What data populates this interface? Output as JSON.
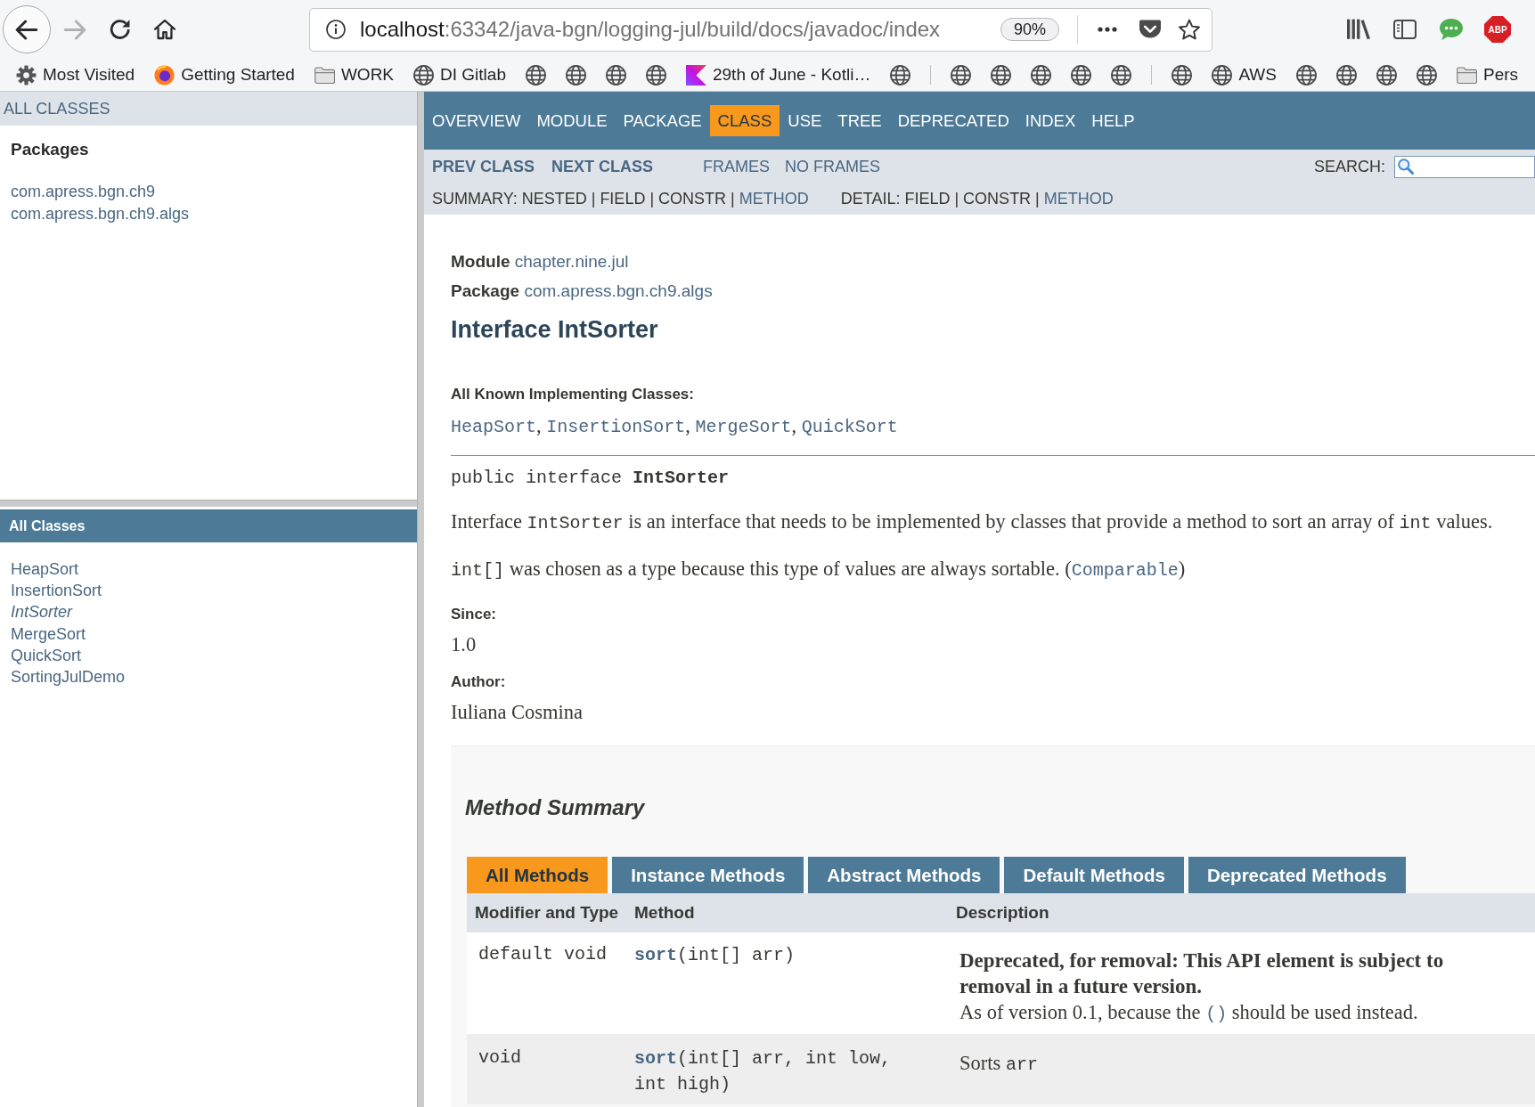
{
  "browser": {
    "nav_buttons": [
      {
        "kind": "back",
        "disabled": false
      },
      {
        "kind": "forward",
        "disabled": true
      },
      {
        "kind": "reload",
        "disabled": false
      },
      {
        "kind": "home",
        "disabled": false
      }
    ],
    "address": {
      "host": "localhost",
      "path": ":63342/java-bgn/logging-jul/build/docs/javadoc/index",
      "zoom": "90%"
    },
    "adblock_label": "ABP",
    "bookmarks": [
      {
        "kind": "gear",
        "label": "Most Visited"
      },
      {
        "kind": "app_logo",
        "label": "Getting Started"
      },
      {
        "kind": "folder",
        "label": "WORK"
      },
      {
        "kind": "globe",
        "label": "DI Gitlab"
      },
      {
        "kind": "globe"
      },
      {
        "kind": "globe"
      },
      {
        "kind": "globe"
      },
      {
        "kind": "globe"
      },
      {
        "kind": "k_logo",
        "label": "29th of June - Kotli…"
      },
      {
        "kind": "globe"
      },
      {
        "kind": "separator"
      },
      {
        "kind": "globe"
      },
      {
        "kind": "globe"
      },
      {
        "kind": "globe"
      },
      {
        "kind": "globe"
      },
      {
        "kind": "globe"
      },
      {
        "kind": "separator"
      },
      {
        "kind": "globe"
      },
      {
        "kind": "globe",
        "label": "AWS"
      },
      {
        "kind": "globe"
      },
      {
        "kind": "globe"
      },
      {
        "kind": "globe"
      },
      {
        "kind": "globe"
      },
      {
        "kind": "folder",
        "label": "Pers"
      }
    ]
  },
  "left_frame": {
    "header_link": "ALL CLASSES",
    "packages_heading": "Packages",
    "packages": [
      "com.apress.bgn.ch9",
      "com.apress.bgn.ch9.algs"
    ],
    "classes_heading": "All Classes",
    "classes": [
      {
        "name": "HeapSort",
        "kind": "class"
      },
      {
        "name": "InsertionSort",
        "kind": "class"
      },
      {
        "name": "IntSorter",
        "kind": "interface"
      },
      {
        "name": "MergeSort",
        "kind": "class"
      },
      {
        "name": "QuickSort",
        "kind": "class"
      },
      {
        "name": "SortingJulDemo",
        "kind": "class"
      }
    ]
  },
  "top_nav": {
    "items": [
      {
        "label": "OVERVIEW",
        "selected": false
      },
      {
        "label": "MODULE",
        "selected": false
      },
      {
        "label": "PACKAGE",
        "selected": false
      },
      {
        "label": "CLASS",
        "selected": true
      },
      {
        "label": "USE",
        "selected": false
      },
      {
        "label": "TREE",
        "selected": false
      },
      {
        "label": "DEPRECATED",
        "selected": false
      },
      {
        "label": "INDEX",
        "selected": false
      },
      {
        "label": "HELP",
        "selected": false
      }
    ]
  },
  "sub_nav": {
    "class_links": [
      "PREV CLASS",
      "NEXT CLASS"
    ],
    "frame_links": [
      "FRAMES",
      "NO FRAMES"
    ],
    "search_label": "SEARCH:",
    "summary": [
      {
        "text": "SUMMARY: NESTED | FIELD | CONSTR |",
        "kind": "text"
      },
      {
        "text": "METHOD",
        "kind": "link"
      }
    ],
    "detail": [
      {
        "text": "DETAIL: FIELD | CONSTR |",
        "kind": "text"
      },
      {
        "text": "METHOD",
        "kind": "link"
      }
    ]
  },
  "content": {
    "module": {
      "label": "Module",
      "value": "chapter.nine.jul"
    },
    "package": {
      "label": "Package",
      "value": "com.apress.bgn.ch9.algs"
    },
    "title": "Interface IntSorter",
    "implementing": {
      "label": "All Known Implementing Classes:",
      "classes": [
        "HeapSort",
        "InsertionSort",
        "MergeSort",
        "QuickSort"
      ],
      "separator": ","
    },
    "signature": "public interface **IntSorter**",
    "paragraphs": [
      [
        {
          "text": "Interface ",
          "kind": "text"
        },
        {
          "text": "IntSorter",
          "kind": "code"
        },
        {
          "text": " is an interface that needs to be implemented by classes that provide a method to sort an array of ",
          "kind": "text"
        },
        {
          "text": "int",
          "kind": "code"
        },
        {
          "text": " values.",
          "kind": "text"
        }
      ],
      [
        {
          "text": "int[]",
          "kind": "code"
        },
        {
          "text": " was chosen as a type because this type of values are always sortable. (",
          "kind": "text"
        },
        {
          "text": "Comparable",
          "kind": "link"
        },
        {
          "text": ")",
          "kind": "text"
        }
      ]
    ],
    "tags": [
      {
        "label": "Since:",
        "value": "1.0"
      },
      {
        "label": "Author:",
        "value": "Iuliana Cosmina"
      }
    ]
  },
  "method_summary": {
    "title": "Method Summary",
    "tabs": [
      {
        "label": "All Methods",
        "selected": true
      },
      {
        "label": "Instance Methods",
        "selected": false
      },
      {
        "label": "Abstract Methods",
        "selected": false
      },
      {
        "label": "Default Methods",
        "selected": false
      },
      {
        "label": "Deprecated Methods",
        "selected": false
      }
    ],
    "columns": [
      "Modifier and Type",
      "Method",
      "Description"
    ],
    "rows": [
      {
        "modifier": "default void",
        "method": {
          "name": "sort",
          "params": "(int[] arr)"
        },
        "deprecation": "Deprecated, for removal: This API element is subject to removal in a future version.",
        "description": [
          {
            "text": "As of version 0.1, because the ",
            "kind": "text"
          },
          {
            "text": "()",
            "kind": "link"
          },
          {
            "text": " should be used instead.",
            "kind": "text"
          }
        ]
      },
      {
        "modifier": "void",
        "method": {
          "name": "sort",
          "params": "(int[] arr, int low, int high)"
        },
        "description": [
          {
            "text": "Sorts ",
            "kind": "text"
          },
          {
            "text": "arr",
            "kind": "code"
          }
        ]
      }
    ]
  }
}
